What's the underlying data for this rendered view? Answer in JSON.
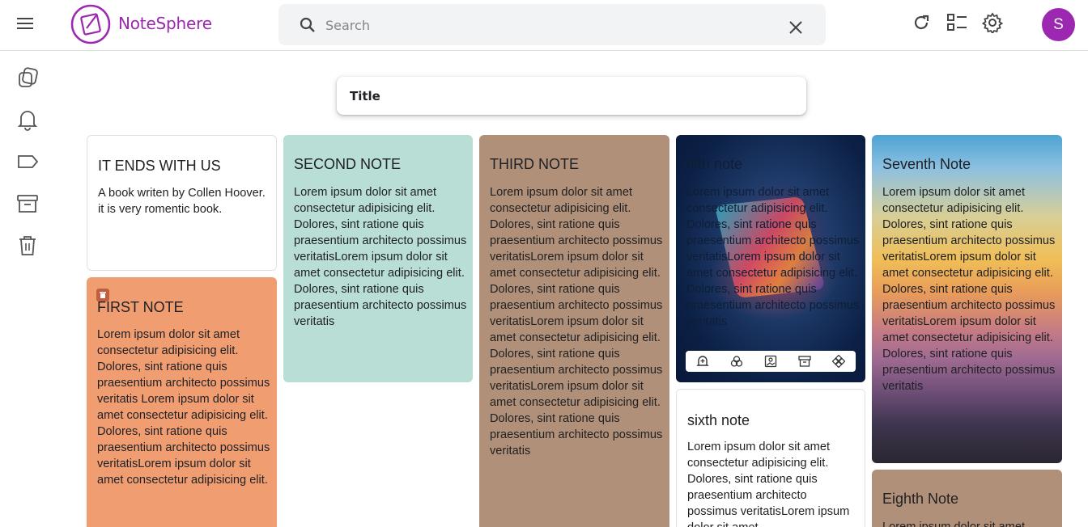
{
  "app": {
    "name": "NoteSphere",
    "avatar_letter": "S",
    "accent_color": "#9c27b0"
  },
  "header": {
    "menu_icon": "hamburger-menu-icon",
    "search": {
      "placeholder": "Search",
      "value": ""
    },
    "icons": [
      "refresh-icon",
      "list-view-icon",
      "settings-icon"
    ]
  },
  "sidebar": {
    "items": [
      {
        "name": "notes",
        "icon": "notes-icon"
      },
      {
        "name": "reminders",
        "icon": "bell-icon"
      },
      {
        "name": "labels",
        "icon": "label-icon"
      },
      {
        "name": "archive",
        "icon": "archive-icon"
      },
      {
        "name": "trash",
        "icon": "trash-icon"
      }
    ]
  },
  "composer": {
    "placeholder": "Title"
  },
  "notes": [
    {
      "title": "IT ENDS WITH US",
      "body": "A book writen by Collen Hoover. it is very romentic book.",
      "color": "#ffffff"
    },
    {
      "title": "FIRST NOTE",
      "body": "Lorem ipsum dolor sit amet consectetur adipisicing elit. Dolores, sint ratione quis praesentium architecto possimus veritatis Lorem ipsum dolor sit amet consectetur adipisicing elit. Dolores, sint ratione quis praesentium architecto possimus veritatisLorem ipsum dolor sit amet consectetur adipisicing elit.",
      "color": "#f19d72"
    },
    {
      "title": "SECOND NOTE",
      "body": "Lorem ipsum dolor sit amet consectetur adipisicing elit. Dolores, sint ratione quis praesentium architecto possimus veritatisLorem ipsum dolor sit amet consectetur adipisicing elit. Dolores, sint ratione quis praesentium architecto possimus veritatis",
      "color": "#b9ded5"
    },
    {
      "title": "THIRD NOTE",
      "body": "Lorem ipsum dolor sit amet consectetur adipisicing elit. Dolores, sint ratione quis praesentium architecto possimus veritatisLorem ipsum dolor sit amet consectetur adipisicing elit. Dolores, sint ratione quis praesentium architecto possimus veritatisLorem ipsum dolor sit amet consectetur adipisicing elit. Dolores, sint ratione quis praesentium architecto possimus veritatisLorem ipsum dolor sit amet consectetur adipisicing elit. Dolores, sint ratione quis praesentium architecto possimus veritatis",
      "color": "#b09078"
    },
    {
      "title": "fifth note",
      "body": "Lorem ipsum dolor sit amet consectetur adipisicing elit. Dolores, sint ratione quis praesentium architecto possimus veritatisLorem ipsum dolor sit amet consectetur adipisicing elit. Dolores, sint ratione quis praesentium architecto possimus veritatis",
      "color": "#0c2146"
    },
    {
      "title": "sixth note",
      "body": "Lorem ipsum dolor sit amet consectetur adipisicing elit. Dolores, sint ratione quis praesentium architecto possimus veritatisLorem ipsum dolor sit amet",
      "color": "#ffffff"
    },
    {
      "title": "Seventh Note",
      "body": "Lorem ipsum dolor sit amet consectetur adipisicing elit. Dolores, sint ratione quis praesentium architecto possimus veritatisLorem ipsum dolor sit amet consectetur adipisicing elit. Dolores, sint ratione quis praesentium architecto possimus veritatisLorem ipsum dolor sit amet consectetur adipisicing elit. Dolores, sint ratione quis praesentium architecto possimus veritatis",
      "color": "#e8a060"
    },
    {
      "title": "Eighth Note",
      "body": "Lorem ipsum dolor sit amet",
      "color": "#b09078"
    }
  ],
  "note_toolbar": [
    "reminder-bell-icon",
    "palette-icon",
    "image-icon",
    "archive-icon",
    "more-options-icon"
  ]
}
